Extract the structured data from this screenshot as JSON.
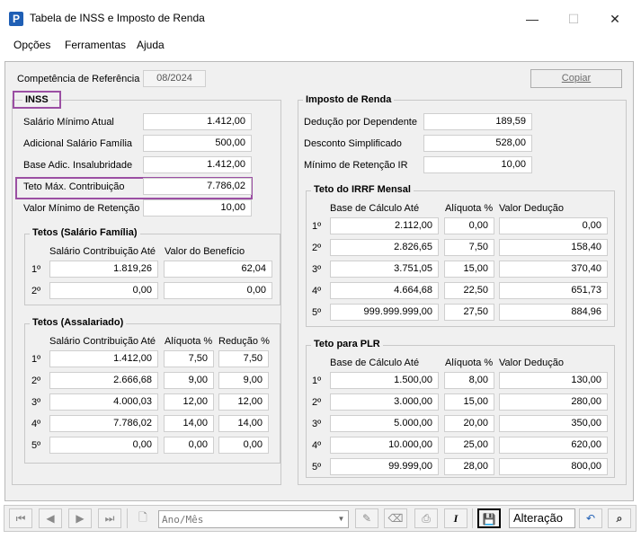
{
  "window": {
    "title": "Tabela de INSS e Imposto de Renda",
    "minimize": "—",
    "maximize": "☐",
    "close": "✕",
    "app_icon_letter": "P"
  },
  "menu": [
    "Opções",
    "Ferramentas",
    "Ajuda"
  ],
  "competencia": {
    "label": "Competência de Referência",
    "value": "08/2024"
  },
  "copy_button": "Copiar",
  "inss": {
    "title": "INSS",
    "rows": [
      {
        "label": "Salário Mínimo Atual",
        "value": "1.412,00"
      },
      {
        "label": "Adicional Salário Família",
        "value": "500,00"
      },
      {
        "label": "Base Adic. Insalubridade",
        "value": "1.412,00"
      },
      {
        "label": "Teto Máx. Contribuição",
        "value": "7.786,02"
      },
      {
        "label": "Valor Mínimo de Retenção",
        "value": "10,00"
      }
    ],
    "familia": {
      "title": "Tetos (Salário Família)",
      "headers": [
        "Salário Contribuição Até",
        "Valor do Benefício"
      ],
      "rows": [
        {
          "n": "1º",
          "ate": "1.819,26",
          "valor": "62,04"
        },
        {
          "n": "2º",
          "ate": "0,00",
          "valor": "0,00"
        }
      ]
    },
    "assalariado": {
      "title": "Tetos (Assalariado)",
      "headers": [
        "Salário Contribuição Até",
        "Alíquota %",
        "Redução %"
      ],
      "rows": [
        {
          "n": "1º",
          "ate": "1.412,00",
          "aliq": "7,50",
          "red": "7,50"
        },
        {
          "n": "2º",
          "ate": "2.666,68",
          "aliq": "9,00",
          "red": "9,00"
        },
        {
          "n": "3º",
          "ate": "4.000,03",
          "aliq": "12,00",
          "red": "12,00"
        },
        {
          "n": "4º",
          "ate": "7.786,02",
          "aliq": "14,00",
          "red": "14,00"
        },
        {
          "n": "5º",
          "ate": "0,00",
          "aliq": "0,00",
          "red": "0,00"
        }
      ]
    }
  },
  "ir": {
    "title": "Imposto de Renda",
    "rows": [
      {
        "label": "Dedução por Dependente",
        "value": "189,59"
      },
      {
        "label": "Desconto Simplificado",
        "value": "528,00"
      },
      {
        "label": "Mínimo de Retenção IR",
        "value": "10,00"
      }
    ],
    "mensal": {
      "title": "Teto do IRRF Mensal",
      "headers": [
        "Base de Cálculo Até",
        "Alíquota %",
        "Valor Dedução"
      ],
      "rows": [
        {
          "n": "1º",
          "base": "2.112,00",
          "aliq": "0,00",
          "ded": "0,00"
        },
        {
          "n": "2º",
          "base": "2.826,65",
          "aliq": "7,50",
          "ded": "158,40"
        },
        {
          "n": "3º",
          "base": "3.751,05",
          "aliq": "15,00",
          "ded": "370,40"
        },
        {
          "n": "4º",
          "base": "4.664,68",
          "aliq": "22,50",
          "ded": "651,73"
        },
        {
          "n": "5º",
          "base": "999.999.999,00",
          "aliq": "27,50",
          "ded": "884,96"
        }
      ]
    },
    "plr": {
      "title": "Teto para PLR",
      "headers": [
        "Base de Cálculo Até",
        "Alíquota %",
        "Valor Dedução"
      ],
      "rows": [
        {
          "n": "1º",
          "base": "1.500,00",
          "aliq": "8,00",
          "ded": "130,00"
        },
        {
          "n": "2º",
          "base": "3.000,00",
          "aliq": "15,00",
          "ded": "280,00"
        },
        {
          "n": "3º",
          "base": "5.000,00",
          "aliq": "20,00",
          "ded": "350,00"
        },
        {
          "n": "4º",
          "base": "10.000,00",
          "aliq": "25,00",
          "ded": "620,00"
        },
        {
          "n": "5º",
          "base": "99.999,00",
          "aliq": "28,00",
          "ded": "800,00"
        }
      ]
    }
  },
  "toolbar": {
    "first": "⏮",
    "prev": "◀",
    "next": "▶",
    "last": "⏭",
    "new": "🗋",
    "combo_placeholder": "Ano/Mês",
    "combo_arrow": "▼",
    "edit_icon": "✎",
    "delete_icon": "⌫",
    "print_icon": "⎙",
    "italic_icon": "I",
    "save_icon": "💾",
    "status": "Alteração",
    "undo_icon": "↶",
    "find_icon": "⌕"
  },
  "colors": {
    "highlight": "#9b4fa3",
    "panel": "#f0f0f0",
    "icon": "#1f5fb5"
  }
}
